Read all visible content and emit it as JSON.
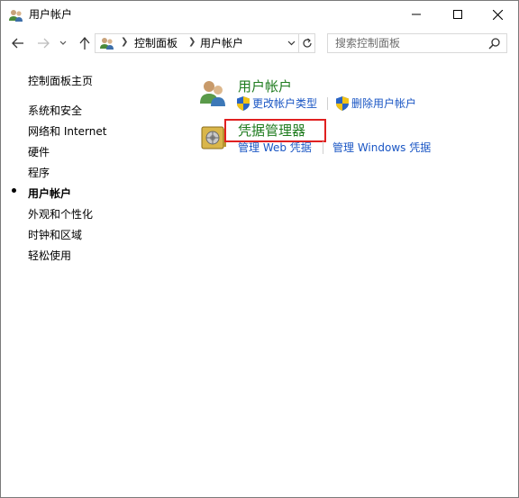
{
  "window": {
    "title": "用户帐户"
  },
  "nav": {
    "breadcrumb": [
      "控制面板",
      "用户帐户"
    ],
    "search_placeholder": "搜索控制面板"
  },
  "left_nav": {
    "items": [
      {
        "label": "控制面板主页",
        "current": false
      },
      {
        "label": "系统和安全",
        "current": false
      },
      {
        "label": "网络和 Internet",
        "current": false
      },
      {
        "label": "硬件",
        "current": false
      },
      {
        "label": "程序",
        "current": false
      },
      {
        "label": "用户帐户",
        "current": true
      },
      {
        "label": "外观和个性化",
        "current": false
      },
      {
        "label": "时钟和区域",
        "current": false
      },
      {
        "label": "轻松使用",
        "current": false
      }
    ]
  },
  "main": {
    "sections": [
      {
        "title": "用户帐户",
        "icon": "users-icon",
        "tasks": [
          "更改帐户类型",
          "删除用户帐户"
        ]
      },
      {
        "title": "凭据管理器",
        "icon": "vault-icon",
        "tasks": [
          "管理 Web 凭据",
          "管理 Windows 凭据"
        ]
      }
    ]
  },
  "colors": {
    "section_title": "#1e7b1e",
    "task_link": "#1a56c4",
    "highlight_border": "#e02020"
  }
}
